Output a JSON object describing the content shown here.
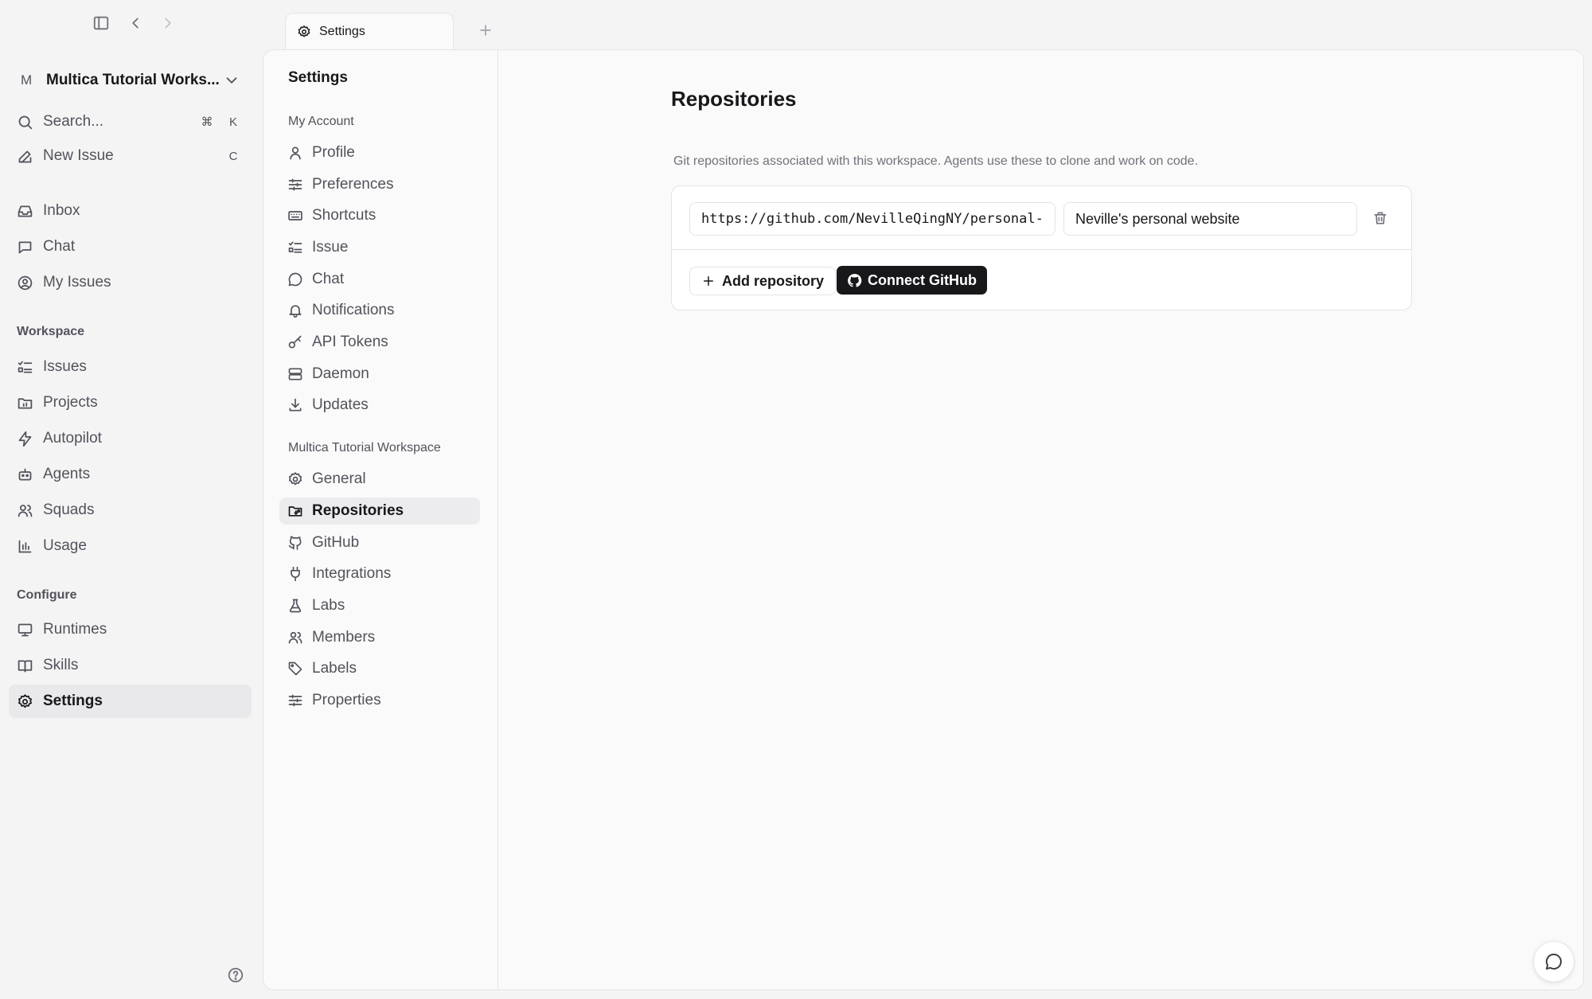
{
  "window": {
    "controls": {
      "sidebar_toggle_icon": "panel-left-icon",
      "back_icon": "chevron-left-icon",
      "forward_icon": "chevron-right-icon"
    }
  },
  "sidebar": {
    "workspace": {
      "avatar": "M",
      "name": "Multica Tutorial Works..."
    },
    "search": {
      "label": "Search...",
      "shortcut_mod": "⌘",
      "shortcut_key": "K"
    },
    "new_issue": {
      "label": "New Issue",
      "shortcut": "C"
    },
    "top_items": [
      {
        "label": "Inbox",
        "icon": "inbox-icon"
      },
      {
        "label": "Chat",
        "icon": "chat-icon"
      },
      {
        "label": "My Issues",
        "icon": "user-circle-icon"
      }
    ],
    "workspace_section": {
      "title": "Workspace",
      "items": [
        {
          "label": "Issues",
          "icon": "list-checks-icon"
        },
        {
          "label": "Projects",
          "icon": "folder-icon"
        },
        {
          "label": "Autopilot",
          "icon": "zap-icon"
        },
        {
          "label": "Agents",
          "icon": "bot-icon"
        },
        {
          "label": "Squads",
          "icon": "users-icon"
        },
        {
          "label": "Usage",
          "icon": "bar-chart-icon"
        }
      ]
    },
    "configure_section": {
      "title": "Configure",
      "items": [
        {
          "label": "Runtimes",
          "icon": "monitor-icon"
        },
        {
          "label": "Skills",
          "icon": "book-icon"
        },
        {
          "label": "Settings",
          "icon": "gear-icon",
          "active": true
        }
      ]
    }
  },
  "tabs": [
    {
      "label": "Settings",
      "icon": "gear-icon"
    }
  ],
  "settings_nav": {
    "title": "Settings",
    "account_section": {
      "title": "My Account",
      "items": [
        {
          "label": "Profile",
          "icon": "user-icon"
        },
        {
          "label": "Preferences",
          "icon": "sliders-icon"
        },
        {
          "label": "Shortcuts",
          "icon": "keyboard-icon"
        },
        {
          "label": "Issue",
          "icon": "list-checks-icon"
        },
        {
          "label": "Chat",
          "icon": "chat-icon"
        },
        {
          "label": "Notifications",
          "icon": "bell-icon"
        },
        {
          "label": "API Tokens",
          "icon": "key-icon"
        },
        {
          "label": "Daemon",
          "icon": "server-icon"
        },
        {
          "label": "Updates",
          "icon": "download-icon"
        }
      ]
    },
    "workspace_section": {
      "title": "Multica Tutorial Workspace",
      "items": [
        {
          "label": "General",
          "icon": "gear-icon"
        },
        {
          "label": "Repositories",
          "icon": "folder-git-icon",
          "active": true
        },
        {
          "label": "GitHub",
          "icon": "github-icon"
        },
        {
          "label": "Integrations",
          "icon": "plug-icon"
        },
        {
          "label": "Labs",
          "icon": "flask-icon"
        },
        {
          "label": "Members",
          "icon": "users-icon"
        },
        {
          "label": "Labels",
          "icon": "tag-icon"
        },
        {
          "label": "Properties",
          "icon": "sliders-icon"
        }
      ]
    }
  },
  "repositories": {
    "title": "Repositories",
    "description": "Git repositories associated with this workspace. Agents use these to clone and work on code.",
    "items": [
      {
        "url": "https://github.com/NevilleQingNY/personal-website",
        "description": "Neville's personal website"
      }
    ],
    "add_label": "Add repository",
    "connect_label": "Connect GitHub"
  }
}
